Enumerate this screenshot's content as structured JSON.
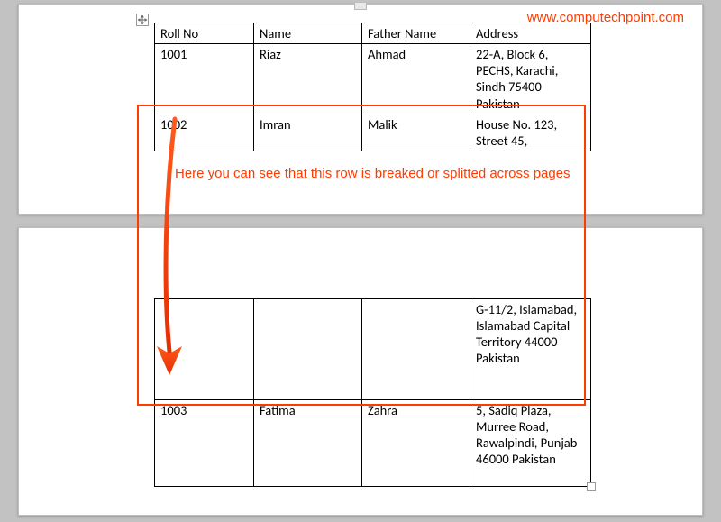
{
  "watermark": "www.computechpoint.com",
  "annotation": "Here you can see that this row is breaked or splitted across pages",
  "table": {
    "headers": [
      "Roll No",
      "Name",
      "Father Name",
      "Address"
    ],
    "rows": [
      {
        "roll": "1001",
        "name": "Riaz",
        "father": "Ahmad",
        "address": "22-A, Block 6, PECHS, Karachi, Sindh 75400 Pakistan"
      },
      {
        "roll": "1002",
        "name": "Imran",
        "father": "Malik",
        "address_part1": "House No. 123, Street 45,",
        "address_part2": "G-11/2, Islamabad, Islamabad Capital Territory 44000\nPakistan"
      },
      {
        "roll": "1003",
        "name": "Fatima",
        "father": "Zahra",
        "address": "5, Sadiq Plaza, Murree Road, Rawalpindi, Punjab 46000 Pakistan"
      }
    ]
  }
}
